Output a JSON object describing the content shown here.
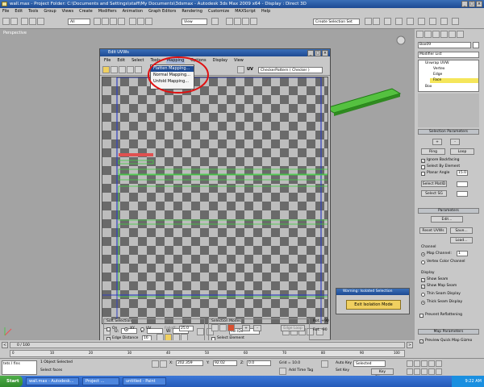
{
  "window": {
    "title": "wall.max   - Project Folder: C:\\Documents and Settings\\staff\\My Documents\\3dsmax    - Autodesk 3ds Max  2009 x64      - Display : Direct 3D"
  },
  "menubar": [
    "File",
    "Edit",
    "Tools",
    "Group",
    "Views",
    "Create",
    "Modifiers",
    "Animation",
    "Graph Editors",
    "Rendering",
    "Customize",
    "MAXScript",
    "Help"
  ],
  "toolbar": {
    "filter": "All",
    "refcoord": "View",
    "selection_set": "Create Selection Set"
  },
  "viewport": {
    "label": "Perspective"
  },
  "uvw_editor": {
    "title": "Edit UVWs",
    "menu": [
      "File",
      "Edit",
      "Select",
      "Tools",
      "Mapping",
      "Options",
      "Display",
      "View"
    ],
    "open_menu_items": [
      "Flatten Mapping...",
      "Normal Mapping...",
      "Unfold Mapping..."
    ],
    "uv_label": "UV",
    "pattern": "CheckerPattern  ( Checker )",
    "u_label": "U:",
    "v_label": "V:",
    "w_label": "W:",
    "ids": "All IDs",
    "soft_selection": {
      "header": "Soft Selection",
      "on": "On",
      "xy": "XY",
      "uv": "UV",
      "falloff_label": "Falloff:",
      "falloff": "25.0",
      "edge_distance": "Edge Distance",
      "edge_distance_value": "16"
    },
    "selection_modes": {
      "header": "Selection Modes",
      "edge_loop": "Edge Loop",
      "select_element": "Select Element"
    },
    "rot_p90": "Rot. +90",
    "rot_m90": "Rot. -90",
    "options": "Options..."
  },
  "warning": {
    "title": "Warning: Isolated Selection",
    "button": "Exit Isolation Mode"
  },
  "command_panel": {
    "object_name": "Box09",
    "modifier_list": "Modifier List",
    "stack": [
      "Unwrap UVW",
      "Vertex",
      "Edge",
      "Face",
      "Box"
    ],
    "selection_parameters": {
      "header": "Selection Parameters",
      "ring": "Ring",
      "loop": "Loop",
      "ignore_backfacing": "Ignore Backfacing",
      "select_by_element": "Select By Element",
      "planar_angle": "Planar Angle",
      "planar_value": "15.0",
      "select_matid": "Select MatID",
      "select_sg": "Select SG"
    },
    "parameters": {
      "header": "Parameters",
      "edit": "Edit...",
      "reset": "Reset UVWs",
      "save": "Save...",
      "load": "Load...",
      "channel": "Channel",
      "map_channel": "Map Channel:",
      "map_channel_value": "1",
      "vertex_color": "Vertex Color Channel"
    },
    "display": {
      "header": "Display",
      "show_seam": "Show Seam",
      "show_map_seam": "Show Map Seam",
      "thin_seam": "Thin Seam Display",
      "thick_seam": "Thick Seam Display"
    },
    "prevent_reflattening": "Prevent Reflattening",
    "map_parameters": {
      "header": "Map Parameters",
      "preview": "Preview Quick Map Gizmo"
    }
  },
  "timeline": {
    "frame": "0 / 100",
    "ticks": [
      "0",
      "10",
      "20",
      "30",
      "40",
      "50",
      "60",
      "70",
      "80",
      "90",
      "100"
    ]
  },
  "status": {
    "objects": "1 Object Selected",
    "prompt": "Select faces",
    "x": "202.359",
    "y": "92.02",
    "z": "0.0",
    "grid": "Grid = 10.0",
    "auto_key": "Auto Key",
    "set_key": "Set Key",
    "selected": "Selected",
    "key_filters": "Key Filters...",
    "add_time_tag": "Add Time Tag",
    "listener": "tets l fins"
  },
  "taskbar": {
    "start": "Start",
    "tasks": [
      "wall.max - Autodesk...",
      "Project ...",
      "untitled - Paint"
    ],
    "clock": "9:22 AM"
  }
}
